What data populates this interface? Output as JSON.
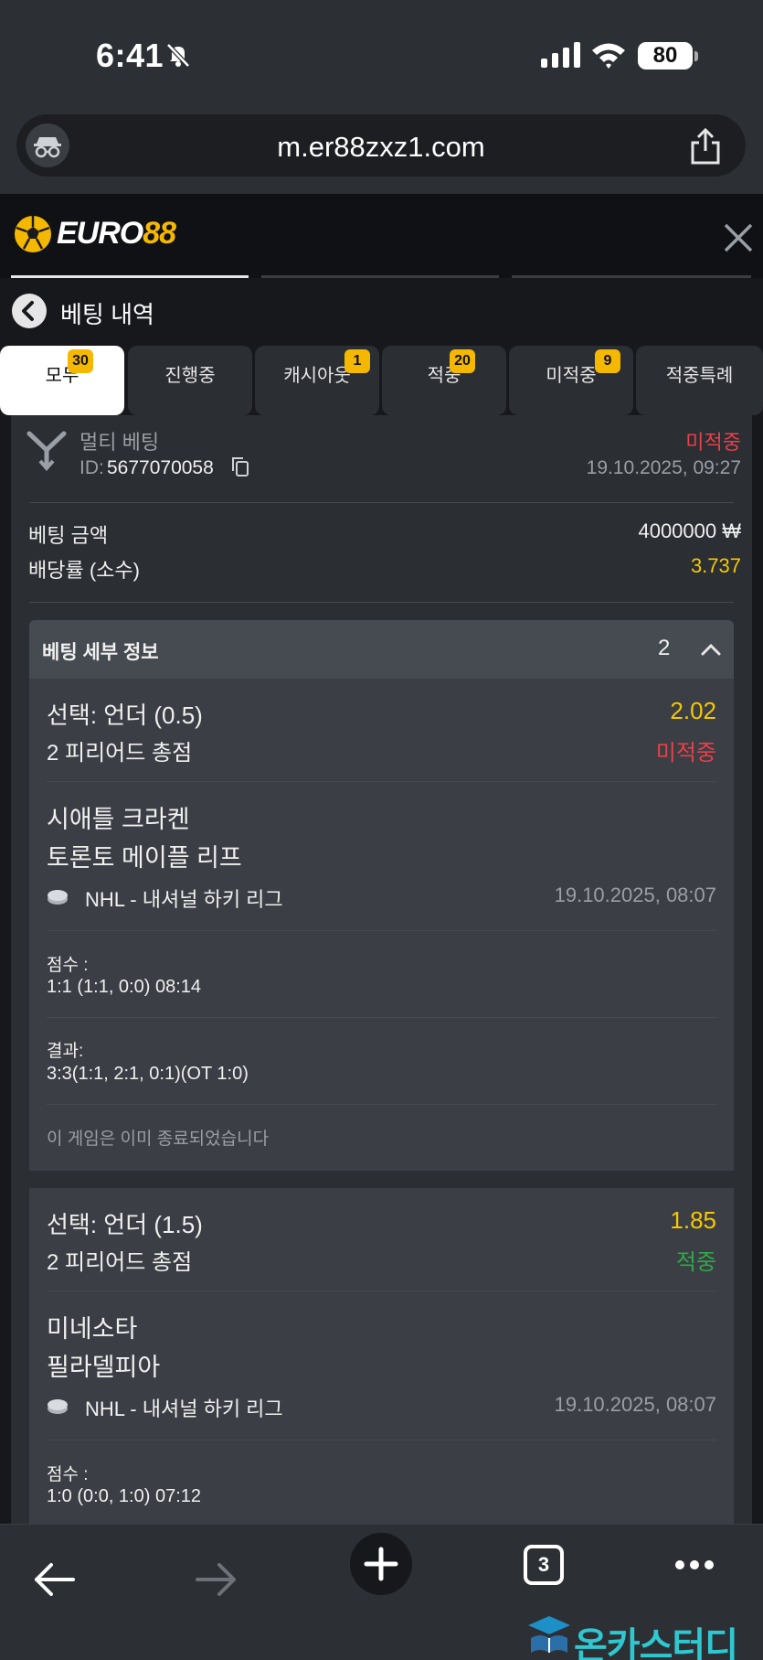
{
  "status": {
    "time": "6:41",
    "battery": "80"
  },
  "browser": {
    "url": "m.er88zxz1.com",
    "tab_count": "3"
  },
  "app": {
    "logo_main": "EURO",
    "logo_accent": "88"
  },
  "page": {
    "title": "베팅 내역"
  },
  "tabs": [
    {
      "label": "모두",
      "badge": "30"
    },
    {
      "label": "진행중",
      "badge": ""
    },
    {
      "label": "캐시아웃",
      "badge": "1"
    },
    {
      "label": "적중",
      "badge": "20"
    },
    {
      "label": "미적중",
      "badge": "9"
    },
    {
      "label": "적중특례",
      "badge": ""
    }
  ],
  "bet": {
    "type": "멀티 베팅",
    "id_label": "ID:",
    "id": "5677070058",
    "status": "미적중",
    "datetime": "19.10.2025, 09:27",
    "amount_label": "베팅 금액",
    "amount": "4000000 ₩",
    "odds_label": "배당률 (소수)",
    "odds": "3.737",
    "details_label": "베팅 세부 정보",
    "details_count": "2"
  },
  "selections": [
    {
      "pick": "선택: 언더 (0.5)",
      "odds": "2.02",
      "market": "2 피리어드 총점",
      "result": "미적중",
      "team1": "시애틀 크라켄",
      "team2": "토론토 메이플 리프",
      "league": "NHL - 내셔널 하키 리그",
      "datetime": "19.10.2025, 08:07",
      "score_label": "점수 :",
      "score": "1:1 (1:1, 0:0) 08:14",
      "final_label": "결과:",
      "final": "3:3(1:1, 2:1, 0:1)(OT 1:0)",
      "note": "이 게임은 이미 종료되었습니다"
    },
    {
      "pick": "선택: 언더 (1.5)",
      "odds": "1.85",
      "market": "2 피리어드 총점",
      "result": "적중",
      "team1": "미네소타",
      "team2": "필라델피아",
      "league": "NHL - 내셔널 하키 리그",
      "datetime": "19.10.2025, 08:07",
      "score_label": "점수 :",
      "score": "1:0 (0:0, 1:0) 07:12"
    }
  ],
  "watermark": "온카스터디",
  "colors": {
    "accent": "#f5b800",
    "lost": "#e8404a",
    "won": "#2eaa48",
    "odds": "#f5c800"
  }
}
